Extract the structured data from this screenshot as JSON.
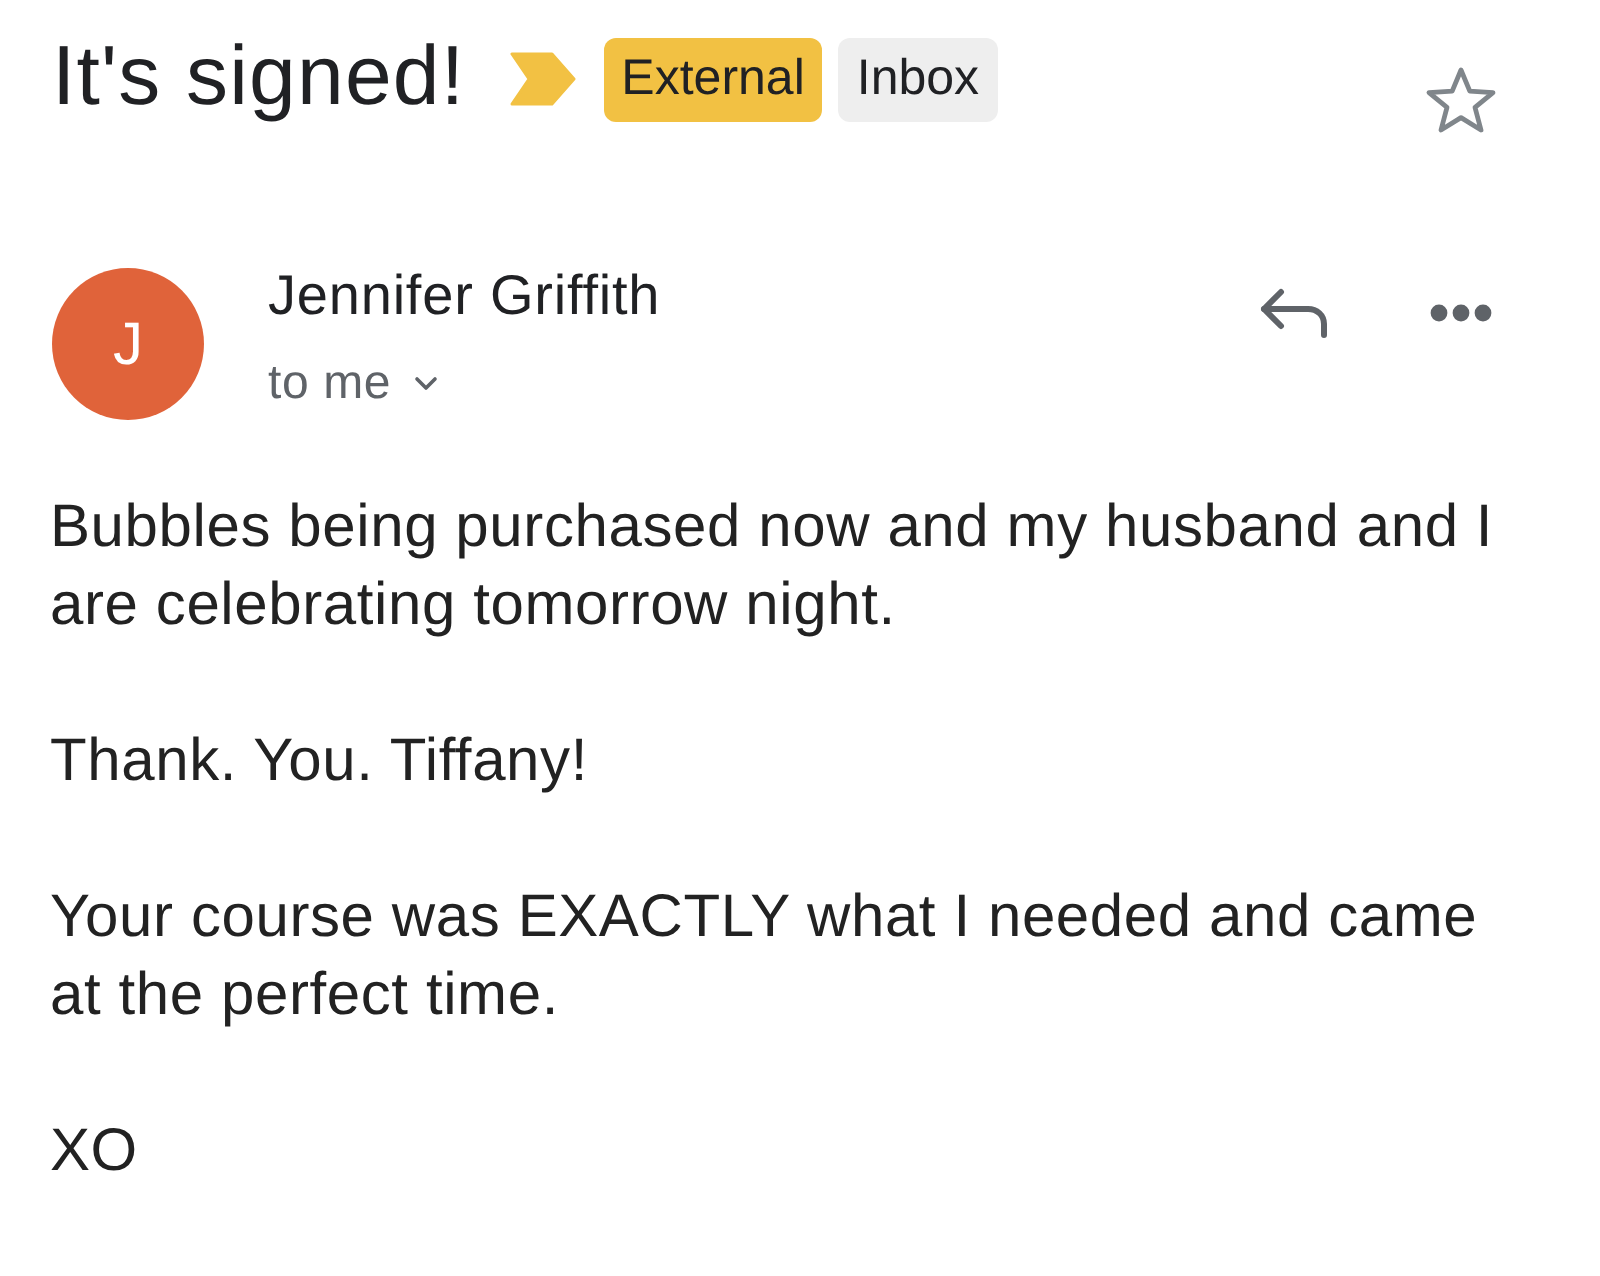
{
  "subject": "It's signed!",
  "important": true,
  "labels": [
    {
      "text": "External",
      "color": "#f2c143"
    },
    {
      "text": "Inbox",
      "color": "#eeeeee"
    }
  ],
  "starred": false,
  "sender": {
    "initial": "J",
    "name": "Jennifer Griffith",
    "recipient": "to me"
  },
  "body": [
    "Bubbles being purchased now and my husband and I are celebrating tomorrow night.",
    "Thank. You. Tiffany!",
    "Your course was EXACTLY what I needed and came at the perfect time.",
    "XO"
  ]
}
